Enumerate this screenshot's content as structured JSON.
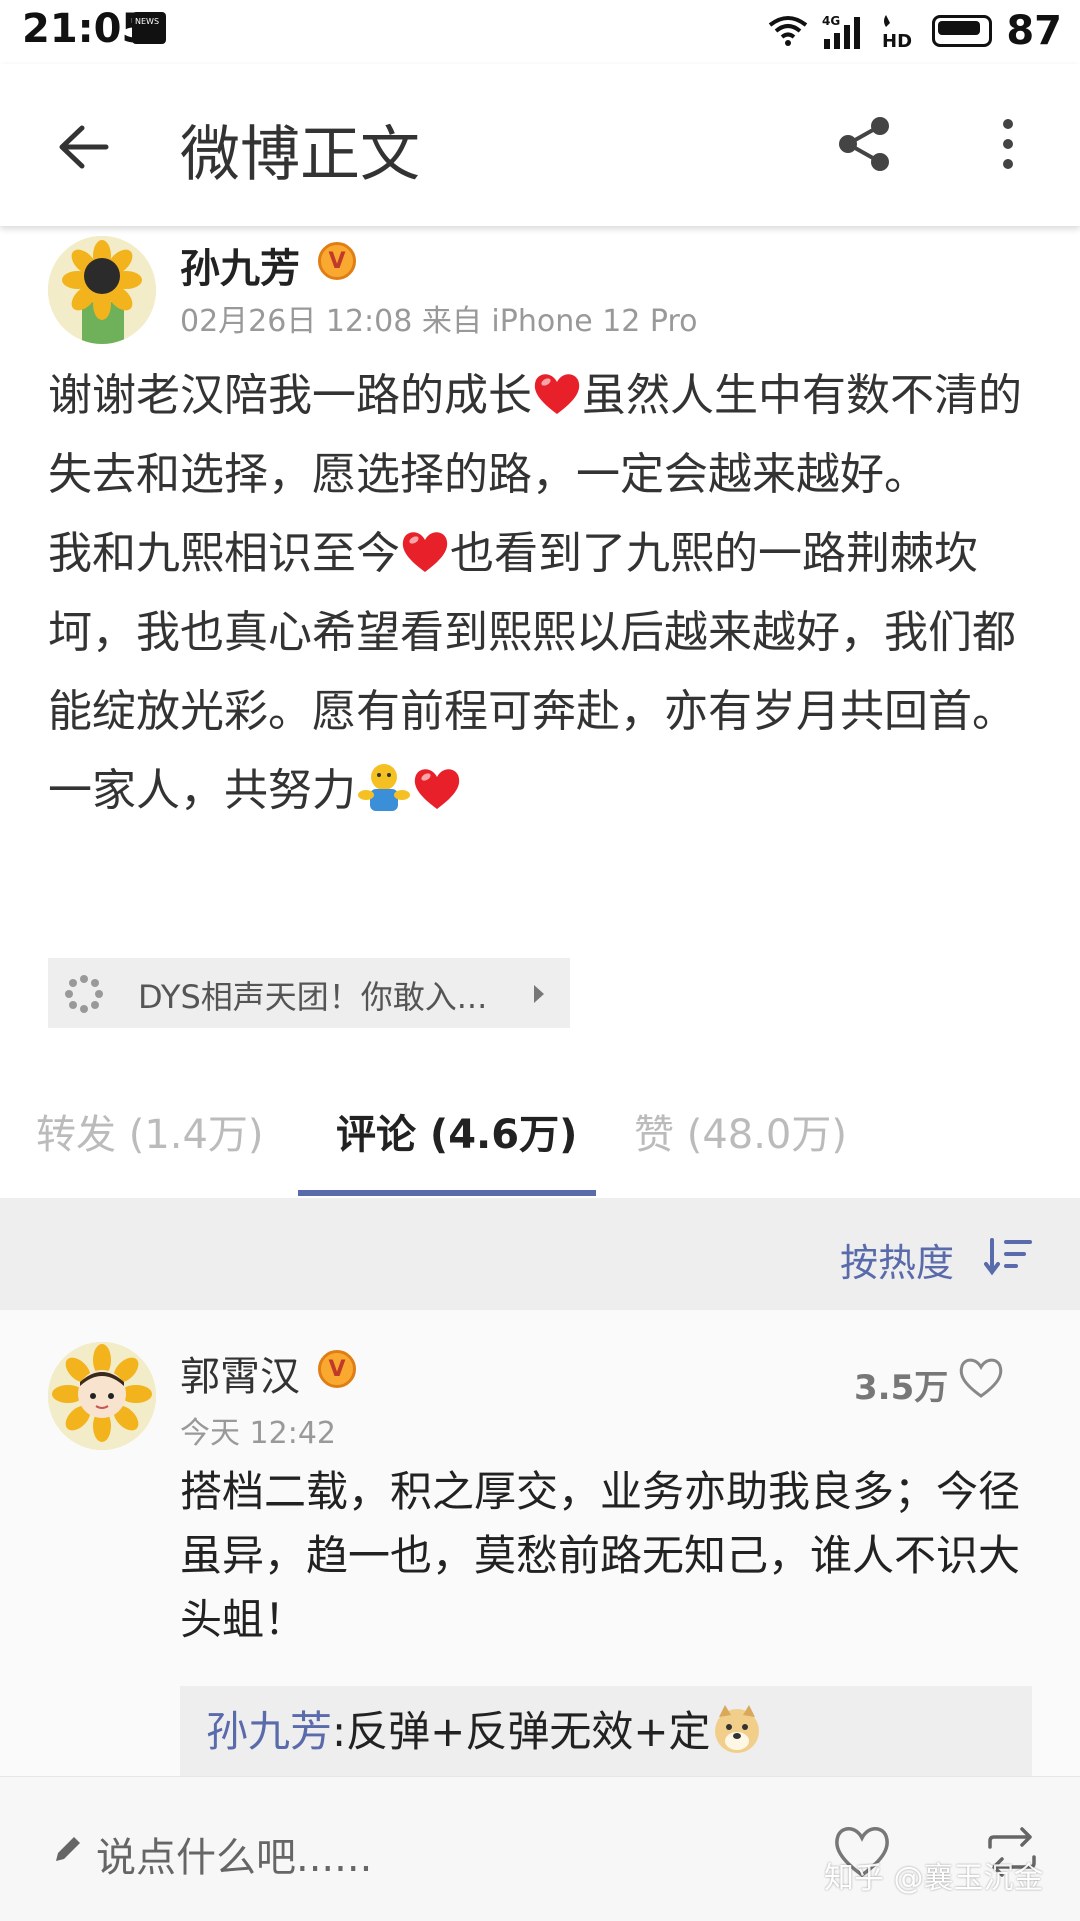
{
  "status_bar": {
    "time": "21:05",
    "battery": "87",
    "network": "4G",
    "hd": "HD"
  },
  "header": {
    "title": "微博正文"
  },
  "post": {
    "author": "孙九芳",
    "meta": "02月26日 12:08   来自 iPhone 12 Pro",
    "lines": [
      {
        "parts": [
          "谢谢老汉陪我一路的成长",
          "[heart]",
          "虽然人生中有数不清的失去和选择，愿选择的路，一定会越来越好。"
        ]
      },
      {
        "parts": [
          "我和九熙相识至今",
          "[heart]",
          "也看到了九熙的一路荆棘坎坷，我也真心希望看到熙熙以后越来越好，我们都能绽放光彩。愿有前程可奔赴，亦有岁月共回首。一家人，共努力",
          "[hug]",
          "[heart]"
        ]
      }
    ],
    "topic_label": "DYS相声天团！你敢入..."
  },
  "tabs": {
    "repost": "转发 (1.4万)",
    "comment": "评论 (4.6万)",
    "like": "赞 (48.0万)"
  },
  "sort": {
    "label": "按热度"
  },
  "comment": {
    "author": "郭霄汉",
    "time": "今天 12:42",
    "likes": "3.5万",
    "text": "搭档二载，积之厚交，业务亦助我良多；今径虽异，趋一也，莫愁前路无知己，谁人不识大头蛆！",
    "reply_name": "孙九芳",
    "reply_text": ":反弹+反弹无效+定"
  },
  "bottom_bar": {
    "placeholder": "说点什么吧......",
    "watermark": "知乎 @襄玉沉金"
  },
  "icons": {
    "back": "arrow-left-icon",
    "share": "share-icon",
    "more": "more-vertical-icon",
    "sort": "sort-icon",
    "like": "heart-outline-icon",
    "repost": "repost-icon",
    "pencil": "pencil-icon",
    "verified": "verified-badge-icon"
  },
  "colors": {
    "accent": "#5a6bab",
    "badge": "#f9a92f",
    "heart": "#e8202a"
  }
}
